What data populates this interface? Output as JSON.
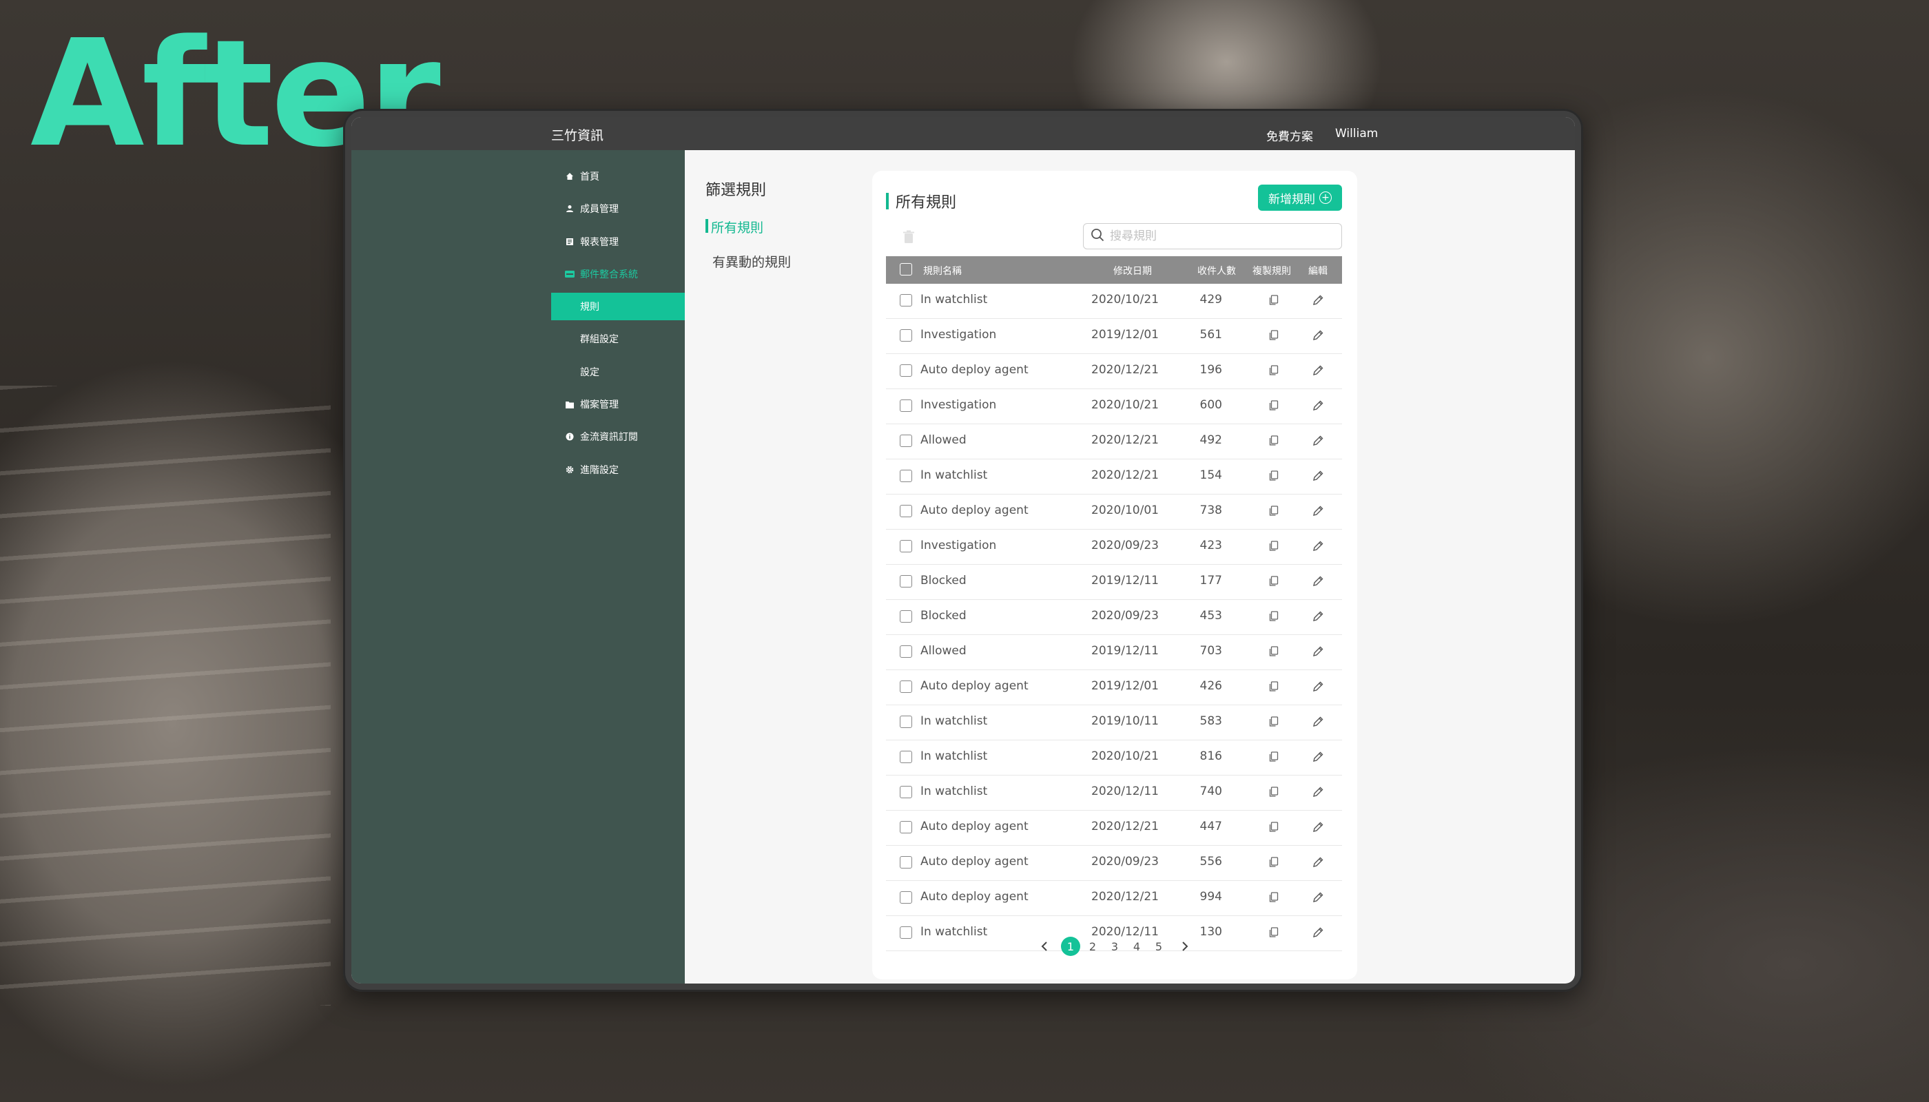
{
  "overlay_text": "After",
  "topbar": {
    "brand": "三竹資訊",
    "plan": "免費方案",
    "user": "William"
  },
  "sidebar": {
    "items": [
      {
        "label": "首頁",
        "icon": "home-icon"
      },
      {
        "label": "成員管理",
        "icon": "user-icon"
      },
      {
        "label": "報表管理",
        "icon": "report-icon"
      },
      {
        "label": "郵件整合系統",
        "icon": "mail-icon"
      },
      {
        "label": "檔案管理",
        "icon": "folder-icon"
      },
      {
        "label": "金流資訊訂閱",
        "icon": "info-icon"
      },
      {
        "label": "進階設定",
        "icon": "gear-icon"
      }
    ],
    "subitems": [
      {
        "label": "規則"
      },
      {
        "label": "群組設定"
      },
      {
        "label": "設定"
      }
    ]
  },
  "filter": {
    "title": "篩選規則",
    "all": "所有規則",
    "changed": "有異動的規則"
  },
  "main": {
    "title": "所有規則",
    "add_label": "新增規則",
    "search_placeholder": "搜尋規則",
    "columns": {
      "name": "規則名稱",
      "date": "修改日期",
      "count": "收件人數",
      "copy": "複製規則",
      "edit": "編輯"
    },
    "rows": [
      {
        "name": "In watchlist",
        "date": "2020/10/21",
        "count": "429"
      },
      {
        "name": "Investigation",
        "date": "2019/12/01",
        "count": "561"
      },
      {
        "name": "Auto deploy agent",
        "date": "2020/12/21",
        "count": "196"
      },
      {
        "name": "Investigation",
        "date": "2020/10/21",
        "count": "600"
      },
      {
        "name": "Allowed",
        "date": "2020/12/21",
        "count": "492"
      },
      {
        "name": "In watchlist",
        "date": "2020/12/21",
        "count": "154"
      },
      {
        "name": "Auto deploy agent",
        "date": "2020/10/01",
        "count": "738"
      },
      {
        "name": "Investigation",
        "date": "2020/09/23",
        "count": "423"
      },
      {
        "name": "Blocked",
        "date": "2019/12/11",
        "count": "177"
      },
      {
        "name": "Blocked",
        "date": "2020/09/23",
        "count": "453"
      },
      {
        "name": "Allowed",
        "date": "2019/12/11",
        "count": "703"
      },
      {
        "name": "Auto deploy agent",
        "date": "2019/12/01",
        "count": "426"
      },
      {
        "name": "In watchlist",
        "date": "2019/10/11",
        "count": "583"
      },
      {
        "name": "In watchlist",
        "date": "2020/10/21",
        "count": "816"
      },
      {
        "name": "In watchlist",
        "date": "2020/12/11",
        "count": "740"
      },
      {
        "name": "Auto deploy agent",
        "date": "2020/12/21",
        "count": "447"
      },
      {
        "name": "Auto deploy agent",
        "date": "2020/09/23",
        "count": "556"
      },
      {
        "name": "Auto deploy agent",
        "date": "2020/12/21",
        "count": "994"
      },
      {
        "name": "In watchlist",
        "date": "2020/12/11",
        "count": "130"
      }
    ],
    "pages": [
      "1",
      "2",
      "3",
      "4",
      "5"
    ],
    "current_page": "1"
  },
  "colors": {
    "accent": "#14c298",
    "sidebar": "#40554f",
    "topbar": "#404040",
    "overlay": "#3ddcb2"
  }
}
